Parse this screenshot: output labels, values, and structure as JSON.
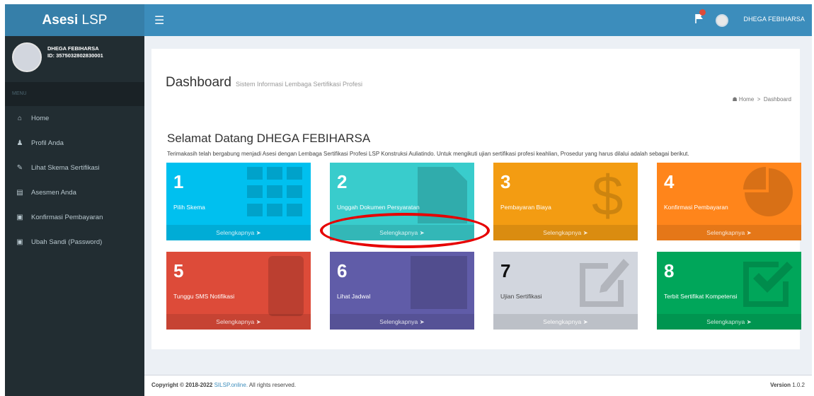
{
  "header": {
    "logo_bold": "Asesi",
    "logo_light": " LSP",
    "menu_icon": "hamburger-icon",
    "user_name": "DHEGA FEBIHARSA"
  },
  "sidebar": {
    "user_name": "DHEGA FEBIHARSA",
    "user_id": "ID: 3575032802830001",
    "section_header": "MENU",
    "items": [
      {
        "label": "Home",
        "icon": "home-icon"
      },
      {
        "label": "Profil Anda",
        "icon": "user-icon"
      },
      {
        "label": "Lihat Skema Sertifikasi",
        "icon": "edit-icon"
      },
      {
        "label": "Asesmen Anda",
        "icon": "file-icon"
      },
      {
        "label": "Konfirmasi Pembayaran",
        "icon": "card-icon"
      },
      {
        "label": "Ubah Sandi (Password)",
        "icon": "lock-icon"
      }
    ]
  },
  "page": {
    "title": "Dashboard",
    "subtitle": "Sistem Informasi Lembaga Sertifikasi Profesi",
    "breadcrumb_home": "Home",
    "breadcrumb_current": "Dashboard",
    "welcome": "Selamat Datang DHEGA FEBIHARSA",
    "description": "Terimakasih telah bergabung menjadi Asesi dengan Lembaga Sertifikasi Profesi LSP Konstruksi Auliatindo. Untuk mengikuti ujian sertifikasi profesi keahlian, Prosedur yang harus dilalui adalah sebagai berikut."
  },
  "tiles": [
    {
      "number": "1",
      "label": "Pilih Skema",
      "more": "Selengkapnya",
      "color": "#00c0ef"
    },
    {
      "number": "2",
      "label": "Unggah Dokumen Persyaratan",
      "more": "Selengkapnya",
      "color": "#39cccc"
    },
    {
      "number": "3",
      "label": "Pembayaran Biaya",
      "more": "Selengkapnya",
      "color": "#f39c12"
    },
    {
      "number": "4",
      "label": "Konfirmasi Pembayaran",
      "more": "Selengkapnya",
      "color": "#ff851b"
    },
    {
      "number": "5",
      "label": "Tunggu SMS Notifikasi",
      "more": "Selengkapnya",
      "color": "#dd4b39"
    },
    {
      "number": "6",
      "label": "Lihat Jadwal",
      "more": "Selengkapnya",
      "color": "#605ca8"
    },
    {
      "number": "7",
      "label": "Ujian Sertifikasi",
      "more": "Selengkapnya",
      "color": "#d2d6de"
    },
    {
      "number": "8",
      "label": "Terbit Sertifikat Kompetensi",
      "more": "Selengkapnya",
      "color": "#00a65a"
    }
  ],
  "footer": {
    "copyright_prefix": "Copyright © 2018-2022 ",
    "copyright_link": "SILSP.online.",
    "copyright_suffix": " All rights reserved.",
    "version_label": "Version",
    "version_value": " 1.0.2"
  }
}
